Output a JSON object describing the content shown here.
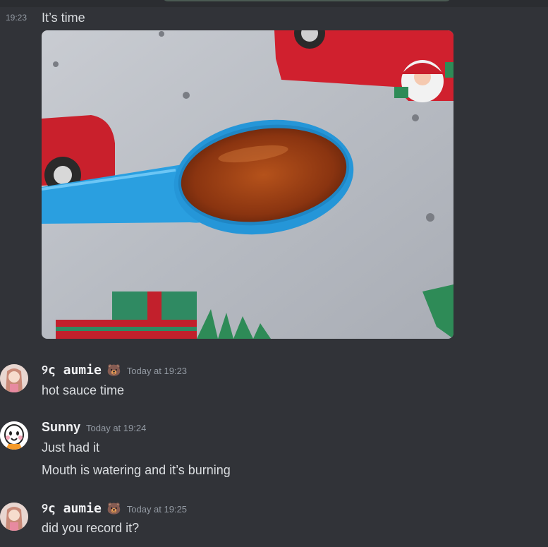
{
  "message_image": {
    "time": "19:23",
    "text": "It’s time"
  },
  "messages": [
    {
      "username": "୨ς aumie",
      "badge": "🐻",
      "timestamp": "Today at 19:23",
      "lines": [
        "hot sauce time"
      ]
    },
    {
      "username": "Sunny",
      "timestamp": "Today at 19:24",
      "lines": [
        "Just had it",
        "Mouth is watering and it’s burning"
      ]
    },
    {
      "username": "୨ς aumie",
      "badge": "🐻",
      "timestamp": "Today at 19:25",
      "lines": [
        "did you record it?"
      ]
    }
  ],
  "colors": {
    "background": "#313338",
    "text": "#dbdee1",
    "muted": "#949ba4",
    "username": "#f2f3f5"
  }
}
